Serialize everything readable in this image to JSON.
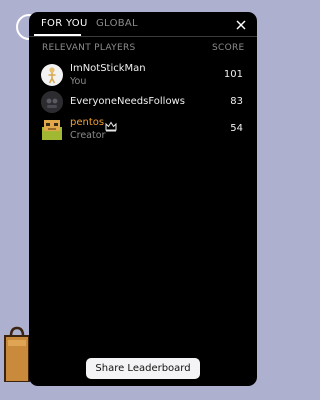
{
  "tabs": [
    {
      "label": "FOR YOU",
      "active": true
    },
    {
      "label": "GLOBAL",
      "active": false
    }
  ],
  "columns": {
    "players": "RELEVANT PLAYERS",
    "score": "SCORE"
  },
  "players": [
    {
      "name": "ImNotStickMan",
      "subtitle": "You",
      "score": "101",
      "icon": "stickman-avatar"
    },
    {
      "name": "EveryoneNeedsFollows",
      "subtitle": "",
      "score": "83",
      "icon": "dark-avatar"
    },
    {
      "name": "pentos",
      "subtitle": "Creator",
      "score": "54",
      "icon": "character-avatar",
      "badge": "crown-icon"
    }
  ],
  "share_button": "Share Leaderboard",
  "colors": {
    "creator_name": "#f0a030",
    "panel_bg": "#000000",
    "page_bg": "#aeb0cf"
  }
}
